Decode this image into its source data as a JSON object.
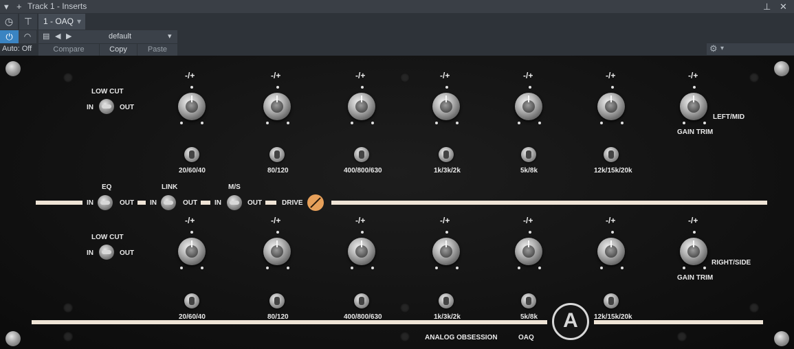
{
  "host": {
    "window_title": "Track 1 - Inserts",
    "insert_tab": "1 - OAQ",
    "automation_label": "Auto: Off",
    "preset_name": "default",
    "compare_label": "Compare",
    "copy_label": "Copy",
    "paste_label": "Paste"
  },
  "plugin": {
    "plus_minus": "-/+",
    "low_cut": "LOW CUT",
    "in": "IN",
    "out": "OUT",
    "gain_trim": "GAIN TRIM",
    "channel_top": "LEFT/MID",
    "channel_bottom": "RIGHT/SIDE",
    "eq": "EQ",
    "link": "LINK",
    "ms": "M/S",
    "drive": "DRIVE",
    "brand": "ANALOG OBSESSION",
    "model": "OAQ",
    "freq_labels": [
      "20/60/40",
      "80/120",
      "400/800/630",
      "1k/3k/2k",
      "5k/8k",
      "12k/15k/20k"
    ]
  }
}
